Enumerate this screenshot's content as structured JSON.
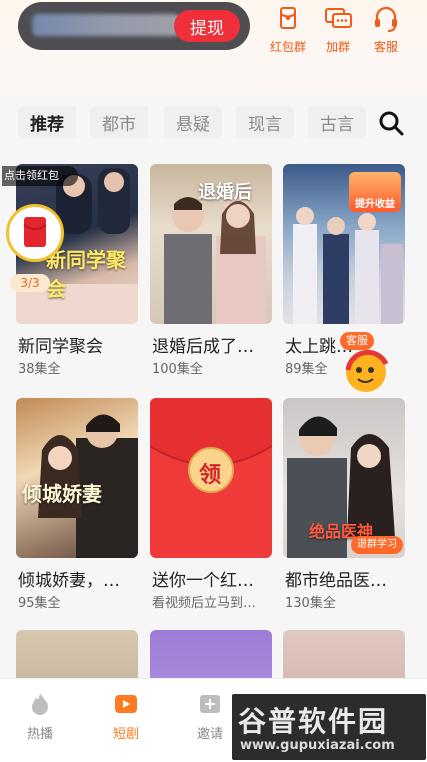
{
  "top": {
    "withdraw_label": "提现",
    "actions": [
      {
        "label": "红包群",
        "icon": "red-envelope-group-icon"
      },
      {
        "label": "加群",
        "icon": "join-group-icon"
      },
      {
        "label": "客服",
        "icon": "customer-service-icon"
      }
    ]
  },
  "tabs": [
    "推荐",
    "都市",
    "悬疑",
    "现言",
    "古言"
  ],
  "floating": {
    "lucky_label": "点击领红包",
    "lucky_count": "3/3",
    "kefu_label": "客服"
  },
  "grid": [
    {
      "title": "新同学聚会",
      "sub": "38集全",
      "poster_text": "新同学聚会"
    },
    {
      "title": "退婚后成了…",
      "sub": "100集全",
      "poster_text": "退婚后"
    },
    {
      "title": "太上跳…",
      "sub": "89集全",
      "poster_text": "",
      "badge": "提升收益"
    },
    {
      "title": "倾城娇妻，…",
      "sub": "95集全",
      "poster_text": "倾城娇妻"
    },
    {
      "title": "送你一个红…",
      "sub": "看视频后立马到…",
      "poster_text": "领"
    },
    {
      "title": "都市绝品医…",
      "sub": "130集全",
      "poster_text": "绝品医神",
      "badge": "退群学习"
    }
  ],
  "bottom_nav": [
    {
      "label": "热播",
      "icon": "flame-icon"
    },
    {
      "label": "短剧",
      "icon": "play-icon"
    },
    {
      "label": "邀请",
      "icon": "invite-icon"
    }
  ],
  "watermark": {
    "title": "谷普软件园",
    "url": "www.gupuxiazai.com"
  }
}
